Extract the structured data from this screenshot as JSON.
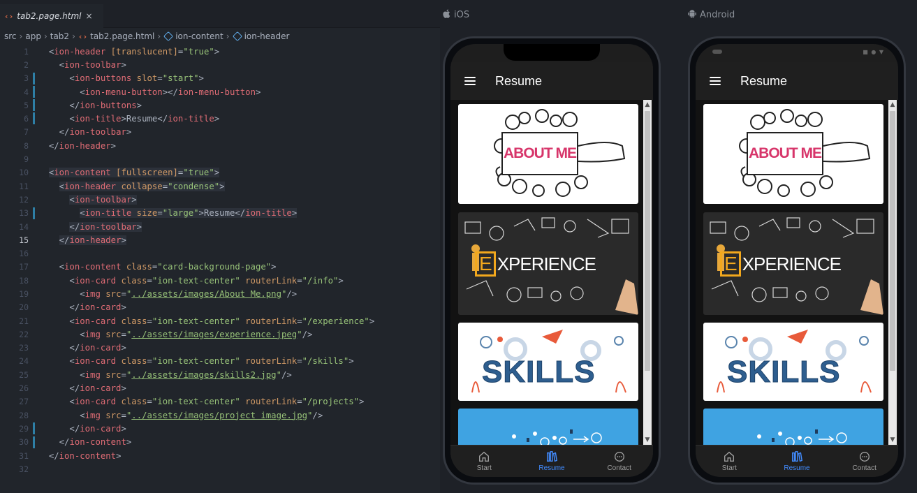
{
  "editor": {
    "tab_name": "tab2.page.html",
    "tab_close": "×",
    "file_icon": "‹›",
    "breadcrumb": [
      "src",
      "app",
      "tab2",
      "tab2.page.html",
      "ion-content",
      "ion-header"
    ],
    "lines": [
      {
        "n": "1"
      },
      {
        "n": "2"
      },
      {
        "n": "3"
      },
      {
        "n": "4"
      },
      {
        "n": "5"
      },
      {
        "n": "6"
      },
      {
        "n": "7"
      },
      {
        "n": "8"
      },
      {
        "n": "9"
      },
      {
        "n": "10"
      },
      {
        "n": "11"
      },
      {
        "n": "12"
      },
      {
        "n": "13"
      },
      {
        "n": "14"
      },
      {
        "n": "15"
      },
      {
        "n": "16"
      },
      {
        "n": "17"
      },
      {
        "n": "18"
      },
      {
        "n": "19"
      },
      {
        "n": "20"
      },
      {
        "n": "21"
      },
      {
        "n": "22"
      },
      {
        "n": "23"
      },
      {
        "n": "24"
      },
      {
        "n": "25"
      },
      {
        "n": "26"
      },
      {
        "n": "27"
      },
      {
        "n": "28"
      },
      {
        "n": "29"
      },
      {
        "n": "30"
      },
      {
        "n": "31"
      },
      {
        "n": "32"
      }
    ],
    "code": {
      "l1": [
        "<",
        "ion-header",
        " [translucent]",
        "=",
        "\"true\"",
        ">"
      ],
      "l2": [
        "<",
        "ion-toolbar",
        ">"
      ],
      "l3": [
        "<",
        "ion-buttons",
        " slot",
        "=",
        "\"start\"",
        ">"
      ],
      "l4": [
        "<",
        "ion-menu-button",
        "></",
        "ion-menu-button",
        ">"
      ],
      "l5": [
        "</",
        "ion-buttons",
        ">"
      ],
      "l6": [
        "<",
        "ion-title",
        ">",
        "Resume",
        "</",
        "ion-title",
        ">"
      ],
      "l7": [
        "</",
        "ion-toolbar",
        ">"
      ],
      "l8": [
        "</",
        "ion-header",
        ">"
      ],
      "l10": [
        "<",
        "ion-content",
        " [fullscreen]",
        "=",
        "\"true\"",
        ">"
      ],
      "l11": [
        "<",
        "ion-header",
        " collapse",
        "=",
        "\"condense\"",
        ">"
      ],
      "l12": [
        "<",
        "ion-toolbar",
        ">"
      ],
      "l13": [
        "<",
        "ion-title",
        " size",
        "=",
        "\"large\"",
        ">",
        "Resume",
        "</",
        "ion-title",
        ">"
      ],
      "l14": [
        "</",
        "ion-toolbar",
        ">"
      ],
      "l15": [
        "</",
        "ion-header",
        ">"
      ],
      "l17": [
        "<",
        "ion-content",
        " class",
        "=",
        "\"card-background-page\"",
        ">"
      ],
      "l18": [
        "<",
        "ion-card",
        " class",
        "=",
        "\"ion-text-center\"",
        " routerLink",
        "=",
        "\"/info\"",
        ">"
      ],
      "l19": [
        "<",
        "img",
        " src",
        "=",
        "\"",
        "../assets/images/About Me.png",
        "\"",
        "/>"
      ],
      "l20": [
        "</",
        "ion-card",
        ">"
      ],
      "l21": [
        "<",
        "ion-card",
        " class",
        "=",
        "\"ion-text-center\"",
        " routerLink",
        "=",
        "\"/experience\"",
        ">"
      ],
      "l22": [
        "<",
        "img",
        " src",
        "=",
        "\"",
        "../assets/images/experience.jpeg",
        "\"",
        "/>"
      ],
      "l23": [
        "</",
        "ion-card",
        ">"
      ],
      "l24": [
        "<",
        "ion-card",
        " class",
        "=",
        "\"ion-text-center\"",
        " routerLink",
        "=",
        "\"/skills\"",
        ">"
      ],
      "l25": [
        "<",
        "img",
        " src",
        "=",
        "\"",
        "../assets/images/skills2.jpg",
        "\"",
        "/>"
      ],
      "l26": [
        "</",
        "ion-card",
        ">"
      ],
      "l27": [
        "<",
        "ion-card",
        " class",
        "=",
        "\"ion-text-center\"",
        " routerLink",
        "=",
        "\"/projects\"",
        ">"
      ],
      "l28": [
        "<",
        "img",
        " src",
        "=",
        "\"",
        "../assets/images/project image.jpg",
        "\"",
        "/>"
      ],
      "l29": [
        "</",
        "ion-card",
        ">"
      ],
      "l30": [
        "</",
        "ion-content",
        ">"
      ],
      "l31": [
        "</",
        "ion-content",
        ">"
      ]
    }
  },
  "preview": {
    "ios_label": "iOS",
    "android_label": "Android",
    "app": {
      "title": "Resume",
      "cards": {
        "about": "ABOUT ME",
        "experience_letter": "E",
        "experience_rest": "XPERIENCE",
        "skills": "SKILLS"
      },
      "tabs": [
        {
          "label": "Start",
          "icon": "home-icon"
        },
        {
          "label": "Resume",
          "icon": "library-icon"
        },
        {
          "label": "Contact",
          "icon": "chat-icon"
        }
      ],
      "active_color": "#428cff"
    }
  }
}
